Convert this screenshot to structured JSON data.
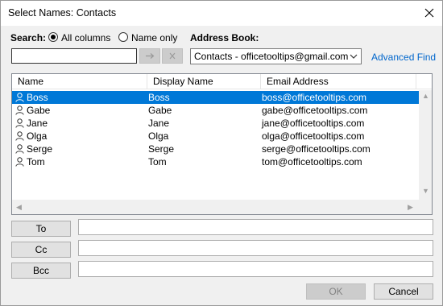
{
  "window": {
    "title": "Select Names: Contacts"
  },
  "search": {
    "label": "Search:",
    "options": [
      {
        "label": "All columns",
        "selected": true
      },
      {
        "label": "Name only",
        "selected": false
      }
    ],
    "value": "",
    "go_icon": "arrow-right-icon",
    "clear_icon": "clear-x-icon"
  },
  "address_book": {
    "label": "Address Book:",
    "selected": "Contacts - officetooltips@gmail.com",
    "advanced_find": "Advanced Find"
  },
  "table": {
    "columns": [
      "Name",
      "Display Name",
      "Email Address"
    ],
    "rows": [
      {
        "name": "Boss",
        "display": "Boss",
        "email": "boss@officetooltips.com",
        "selected": true
      },
      {
        "name": "Gabe",
        "display": "Gabe",
        "email": "gabe@officetooltips.com",
        "selected": false
      },
      {
        "name": "Jane",
        "display": "Jane",
        "email": "jane@officetooltips.com",
        "selected": false
      },
      {
        "name": "Olga",
        "display": "Olga",
        "email": "olga@officetooltips.com",
        "selected": false
      },
      {
        "name": "Serge",
        "display": "Serge",
        "email": "serge@officetooltips.com",
        "selected": false
      },
      {
        "name": "Tom",
        "display": "Tom",
        "email": "tom@officetooltips.com",
        "selected": false
      }
    ]
  },
  "recipients": [
    {
      "label": "To",
      "value": ""
    },
    {
      "label": "Cc",
      "value": ""
    },
    {
      "label": "Bcc",
      "value": ""
    }
  ],
  "buttons": {
    "ok": "OK",
    "cancel": "Cancel",
    "ok_enabled": false
  },
  "colors": {
    "selection": "#0078d7",
    "link": "#0066cc"
  }
}
